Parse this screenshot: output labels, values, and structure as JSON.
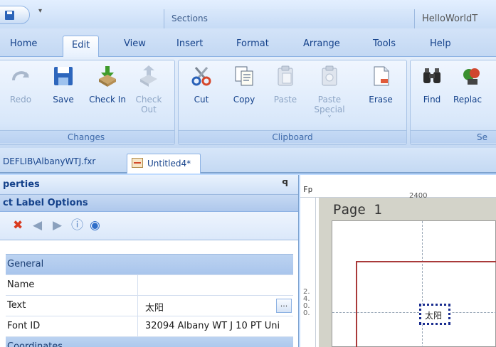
{
  "title_bar": {
    "context_tab": "Sections",
    "app_title": "HelloWorldT"
  },
  "tabs": [
    {
      "label": "Home"
    },
    {
      "label": "Edit",
      "active": true
    },
    {
      "label": "View"
    },
    {
      "label": "Insert"
    },
    {
      "label": "Format"
    },
    {
      "label": "Arrange"
    },
    {
      "label": "Tools"
    },
    {
      "label": "Help"
    }
  ],
  "ribbon": {
    "changes": {
      "label": "Changes",
      "buttons": [
        {
          "label": "Redo",
          "icon": "redo-icon",
          "enabled": false
        },
        {
          "label": "Save",
          "icon": "save-icon",
          "enabled": true
        },
        {
          "label": "Check In",
          "icon": "check-in-icon",
          "enabled": true
        },
        {
          "label": "Check Out",
          "icon": "check-out-icon",
          "enabled": false
        }
      ]
    },
    "clipboard": {
      "label": "Clipboard",
      "buttons": [
        {
          "label": "Cut",
          "icon": "scissors-icon",
          "enabled": true
        },
        {
          "label": "Copy",
          "icon": "copy-icon",
          "enabled": true
        },
        {
          "label": "Paste",
          "icon": "paste-icon",
          "enabled": false
        },
        {
          "label": "Paste Special ˅",
          "icon": "paste-special-icon",
          "enabled": false
        },
        {
          "label": "Erase",
          "icon": "erase-icon",
          "enabled": true
        }
      ]
    },
    "search": {
      "label": "Se",
      "buttons": [
        {
          "label": "Find",
          "icon": "binoculars-icon",
          "enabled": true
        },
        {
          "label": "Replac",
          "icon": "replace-icon",
          "enabled": true
        }
      ]
    }
  },
  "doc_tabs": {
    "path": "DEFLIB\\AlbanyWTJ.fxr",
    "active_tab": "Untitled4*"
  },
  "properties": {
    "title": "perties",
    "subtitle": "ct Label Options",
    "pin_glyph": "ꟼ",
    "rows": [
      {
        "key": "General",
        "category": true
      },
      {
        "key": "Name",
        "value": ""
      },
      {
        "key": "Text",
        "value": "太阳",
        "ellipsis": "..."
      },
      {
        "key": "Font ID",
        "value": "32094 Albany WT J 10 PT Uni"
      },
      {
        "key": "Coordinates",
        "category": true
      }
    ]
  },
  "canvas": {
    "ruler_label": "Fp",
    "ruler_number": "2400",
    "page_title": "Page 1",
    "label_text": "太阳",
    "vruler_text": "2.4.0.0."
  },
  "colors": {
    "ribbon_text": "#15428b",
    "margin_line": "#a93a3a",
    "label_border": "#1a2d8f"
  }
}
